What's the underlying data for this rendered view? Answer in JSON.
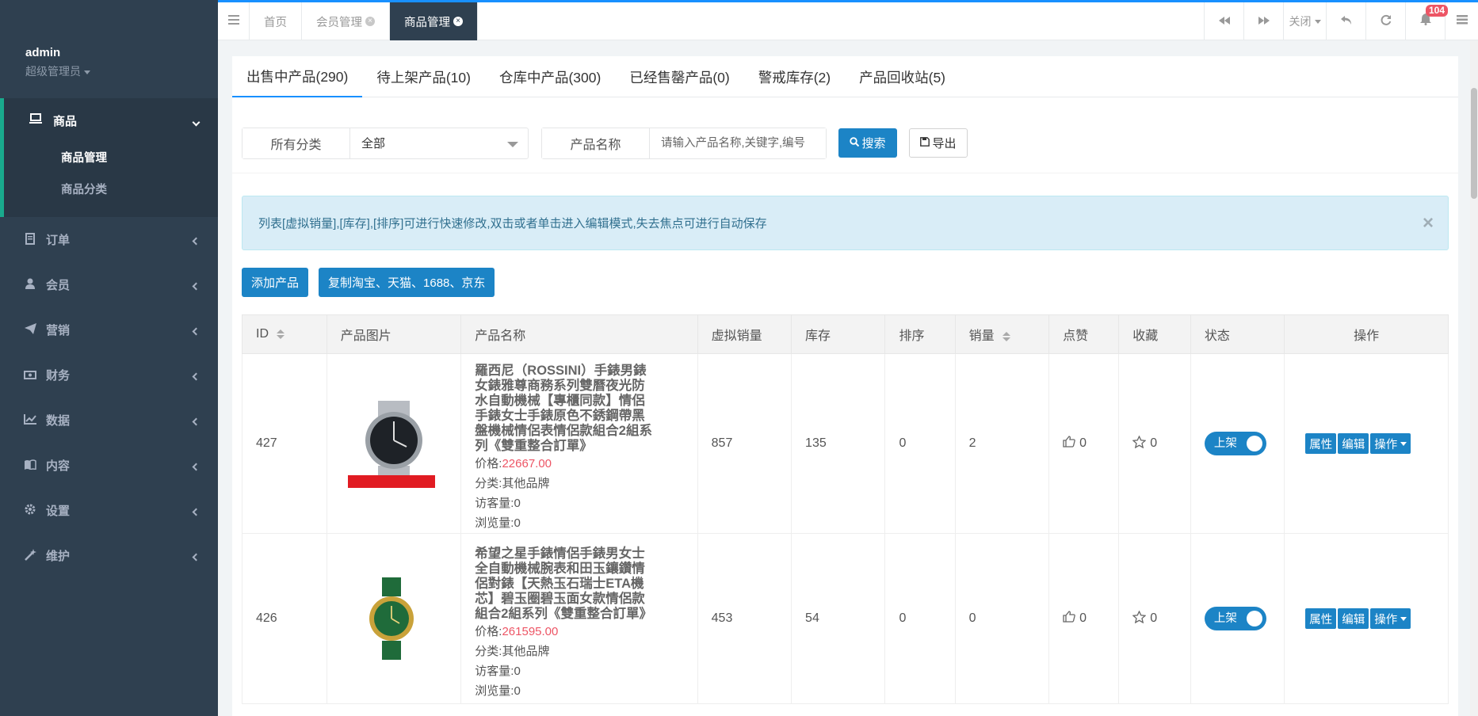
{
  "user": {
    "name": "admin",
    "role": "超级管理员"
  },
  "sidebar": {
    "open_menu": {
      "label": "商品",
      "icon": "laptop-icon",
      "items": [
        {
          "label": "商品管理",
          "active": true
        },
        {
          "label": "商品分类",
          "active": false
        }
      ]
    },
    "menus": [
      {
        "label": "订单",
        "icon": "order-icon"
      },
      {
        "label": "会员",
        "icon": "user-icon"
      },
      {
        "label": "营销",
        "icon": "send-icon"
      },
      {
        "label": "财务",
        "icon": "money-icon"
      },
      {
        "label": "数据",
        "icon": "chart-icon"
      },
      {
        "label": "内容",
        "icon": "book-icon"
      },
      {
        "label": "设置",
        "icon": "gear-icon"
      },
      {
        "label": "维护",
        "icon": "wand-icon"
      }
    ]
  },
  "topbar": {
    "tabs": [
      {
        "label": "首页",
        "closable": false,
        "active": false
      },
      {
        "label": "会员管理",
        "closable": true,
        "active": false
      },
      {
        "label": "商品管理",
        "closable": true,
        "active": true
      }
    ],
    "close_label": "关闭",
    "notification_count": "104"
  },
  "product_tabs": [
    {
      "label": "出售中产品(290)",
      "active": true
    },
    {
      "label": "待上架产品(10)",
      "active": false
    },
    {
      "label": "仓库中产品(300)",
      "active": false
    },
    {
      "label": "已经售罄产品(0)",
      "active": false
    },
    {
      "label": "警戒库存(2)",
      "active": false
    },
    {
      "label": "产品回收站(5)",
      "active": false
    }
  ],
  "filter": {
    "category_label": "所有分类",
    "category_value": "全部",
    "name_label": "产品名称",
    "name_placeholder": "请输入产品名称,关键字,编号",
    "search_label": "搜索",
    "export_label": "导出"
  },
  "alert": {
    "text": "列表[虚拟销量],[库存],[排序]可进行快速修改,双击或者单击进入编辑模式,失去焦点可进行自动保存",
    "close": "×"
  },
  "actions": {
    "add_label": "添加产品",
    "copy_label": "复制淘宝、天猫、1688、京东"
  },
  "table": {
    "headers": [
      "ID",
      "产品图片",
      "产品名称",
      "虚拟销量",
      "库存",
      "排序",
      "销量",
      "点赞",
      "收藏",
      "状态",
      "操作"
    ],
    "rows": [
      {
        "id": "427",
        "name": "羅西尼（ROSSINI）手錶男錶女錶雅尊商務系列雙曆夜光防水自動機械【專櫃同款】情侶手錶女士手錶原色不銹鋼帶黑盤機械情侶表情侶款組合2組系列《雙重整合訂單》",
        "price_label": "价格:",
        "price": "22667.00",
        "category": "分类:其他品牌",
        "visitors": "访客量:0",
        "views": "浏览量:0",
        "virtual_sales": "857",
        "stock": "135",
        "sort": "0",
        "sales": "2",
        "likes": "0",
        "favorites": "0",
        "status": "上架"
      },
      {
        "id": "426",
        "name": "希望之星手錶情侶手錶男女士全自動機械腕表和田玉鑲鑽情侶對錶【天熱玉石瑞士ETA機芯】碧玉圈碧玉面女款情侶款組合2組系列《雙重整合訂單》",
        "price_label": "价格:",
        "price": "261595.00",
        "category": "分类:其他品牌",
        "visitors": "访客量:0",
        "views": "浏览量:0",
        "virtual_sales": "453",
        "stock": "54",
        "sort": "0",
        "sales": "0",
        "likes": "0",
        "favorites": "0",
        "status": "上架"
      }
    ],
    "op_labels": {
      "attr": "属性",
      "edit": "编辑",
      "ops": "操作"
    }
  },
  "colors": {
    "sidebar_bg": "#2f4050",
    "primary": "#1c84c6",
    "price": "#ed5565",
    "badge": "#ed5565"
  }
}
